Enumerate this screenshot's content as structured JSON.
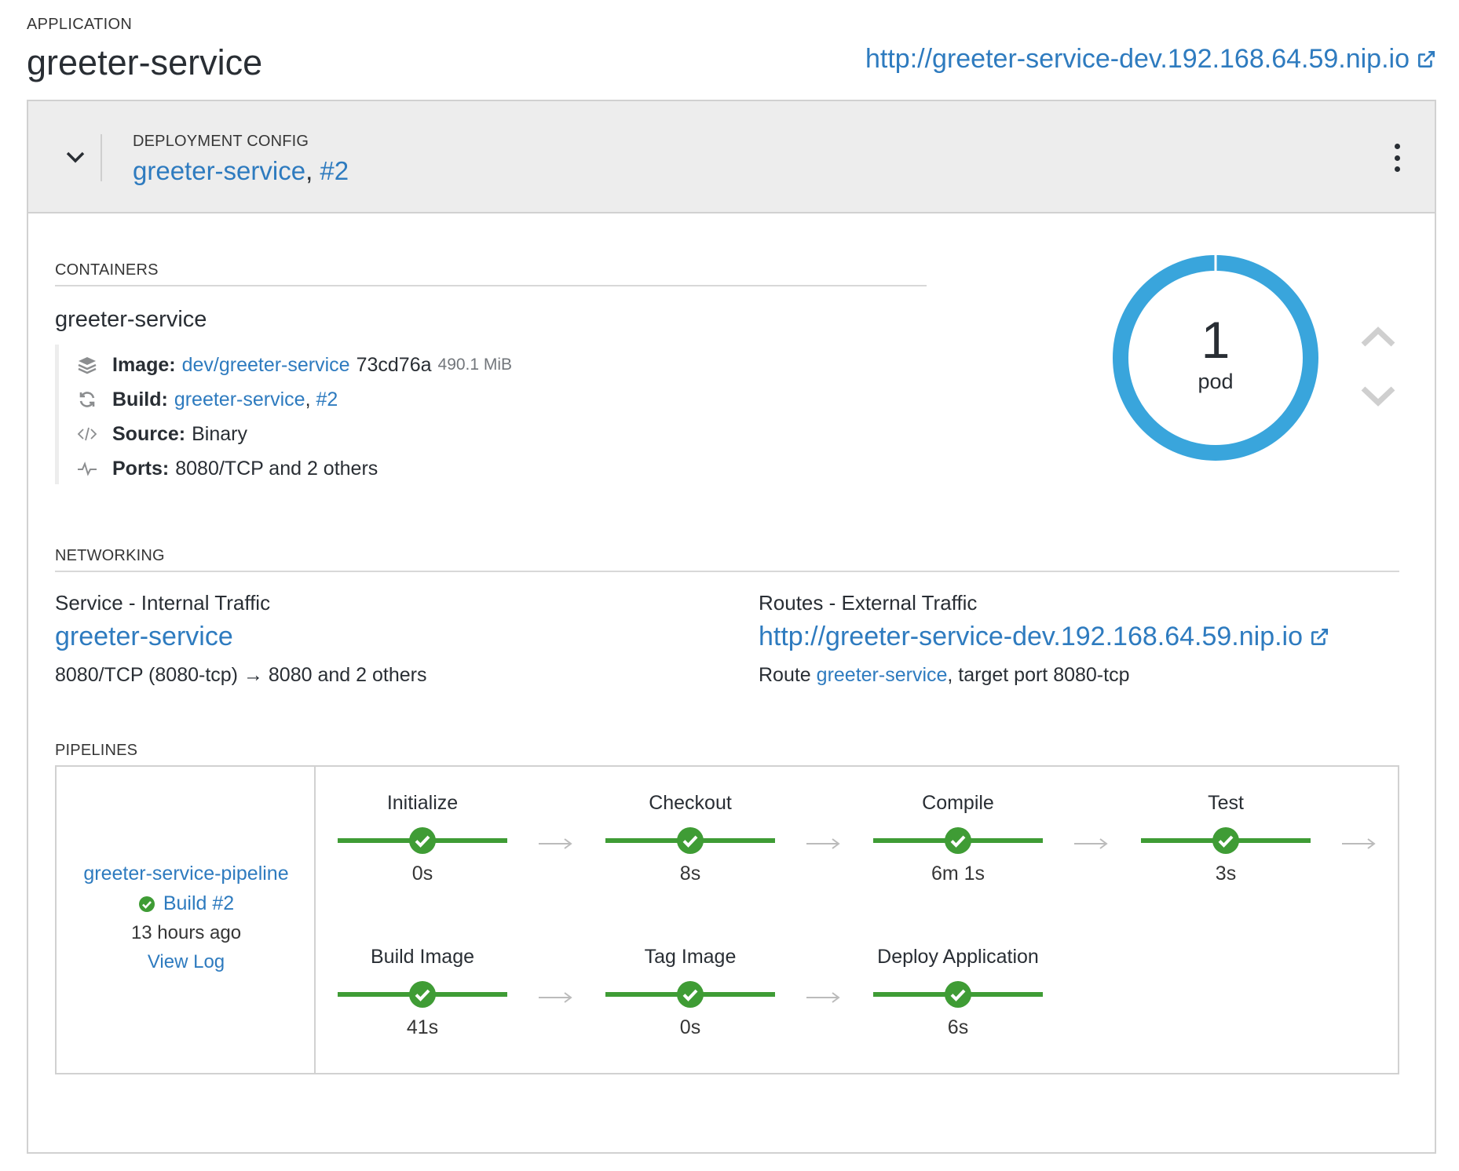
{
  "app": {
    "label": "APPLICATION",
    "title": "greeter-service",
    "url": "http://greeter-service-dev.192.168.64.59.nip.io"
  },
  "deployment": {
    "label": "DEPLOYMENT CONFIG",
    "name": "greeter-service",
    "separator": ",",
    "revision": "#2"
  },
  "containers": {
    "label": "CONTAINERS",
    "name": "greeter-service",
    "image_label": "Image:",
    "image_link": "dev/greeter-service",
    "image_hash": "73cd76a",
    "image_size": "490.1 MiB",
    "build_label": "Build:",
    "build_link": "greeter-service",
    "build_separator": ",",
    "build_revision": "#2",
    "source_label": "Source:",
    "source_value": "Binary",
    "ports_label": "Ports:",
    "ports_value": "8080/TCP and 2 others"
  },
  "pods": {
    "count": "1",
    "unit": "pod",
    "ring_color": "#39a5dc"
  },
  "networking": {
    "label": "NETWORKING",
    "service_heading": "Service - Internal Traffic",
    "service_link": "greeter-service",
    "service_ports_left": "8080/TCP (8080-tcp)",
    "service_ports_arrow": "→",
    "service_ports_right": "8080 and 2 others",
    "routes_heading": "Routes - External Traffic",
    "route_url": "http://greeter-service-dev.192.168.64.59.nip.io",
    "route_prefix": "Route",
    "route_link": "greeter-service",
    "route_suffix": ", target port 8080-tcp"
  },
  "pipelines": {
    "label": "PIPELINES",
    "name": "greeter-service-pipeline",
    "build": "Build #2",
    "time_ago": "13 hours ago",
    "view_log": "View Log",
    "stages": [
      {
        "name": "Initialize",
        "duration": "0s"
      },
      {
        "name": "Checkout",
        "duration": "8s"
      },
      {
        "name": "Compile",
        "duration": "6m 1s"
      },
      {
        "name": "Test",
        "duration": "3s"
      },
      {
        "name": "Build Image",
        "duration": "41s"
      },
      {
        "name": "Tag Image",
        "duration": "0s"
      },
      {
        "name": "Deploy Application",
        "duration": "6s"
      }
    ],
    "success_color": "#3f9c35"
  }
}
